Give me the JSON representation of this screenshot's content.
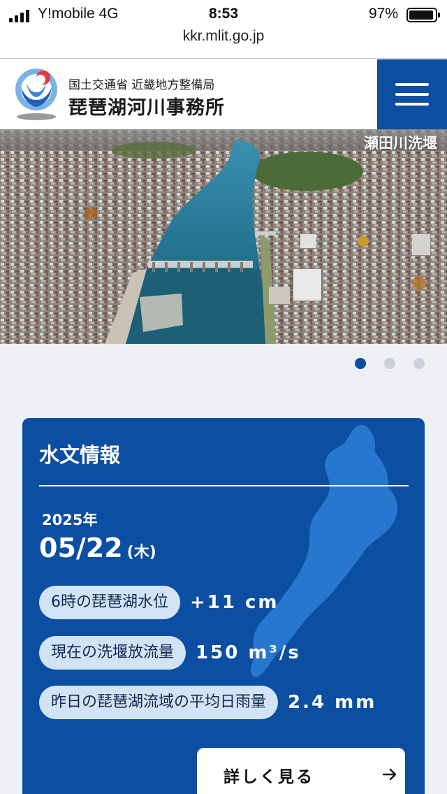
{
  "status": {
    "carrier": "Y!mobile  4G",
    "time": "8:53",
    "battery": "97%"
  },
  "browser": {
    "url": "kkr.mlit.go.jp"
  },
  "header": {
    "org_sub": "国土交通省 近畿地方整備局",
    "org_main": "琵琶湖河川事務所"
  },
  "hero": {
    "caption": "瀬田川洗堰",
    "slide_count": 3,
    "active_slide": 1
  },
  "hydro": {
    "title": "水文情報",
    "year": "2025年",
    "date": "05/22",
    "weekday": "(木)",
    "rows": [
      {
        "label": "6時の琵琶湖水位",
        "value": "+11 cm"
      },
      {
        "label": "現在の洗堰放流量",
        "value": "150 m³/s"
      },
      {
        "label": "昨日の琵琶湖流域の平均日雨量",
        "value": "2.4 mm"
      }
    ],
    "more_label": "詳しく見る"
  },
  "colors": {
    "brand_blue": "#0b4ea2",
    "pill_bg": "#d3e3f6",
    "lake_blue": "#2e7fd6"
  }
}
